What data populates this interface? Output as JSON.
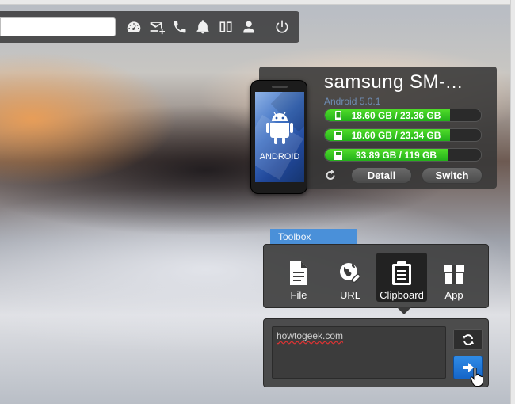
{
  "toolbar": {
    "search_value": "",
    "icons": [
      "dashboard-icon",
      "message-add-icon",
      "phone-icon",
      "bell-icon",
      "dual-screen-icon",
      "user-icon",
      "power-icon"
    ]
  },
  "device": {
    "name": "samsung SM-...",
    "os": "Android 5.0.1",
    "screen_label": "ANDROID",
    "storage": [
      {
        "text": "18.60 GB / 23.36 GB",
        "fill_pct": 80
      },
      {
        "text": "18.60 GB / 23.34 GB",
        "fill_pct": 80
      },
      {
        "text": "93.89 GB / 119 GB",
        "fill_pct": 79
      }
    ],
    "detail_label": "Detail",
    "switch_label": "Switch"
  },
  "toolbox": {
    "tab_label": "Toolbox",
    "tools": [
      {
        "label": "File",
        "icon": "file-icon"
      },
      {
        "label": "URL",
        "icon": "globe-link-icon"
      },
      {
        "label": "Clipboard",
        "icon": "clipboard-icon"
      },
      {
        "label": "App",
        "icon": "app-box-icon"
      }
    ],
    "active_tool": "Clipboard"
  },
  "clipboard": {
    "text": "howtogeek.com"
  },
  "colors": {
    "progress_green": "#3ccb22",
    "accent_blue": "#1a73d6",
    "toolbox_tab": "#4a90d9",
    "os_text": "#6f8db4"
  }
}
